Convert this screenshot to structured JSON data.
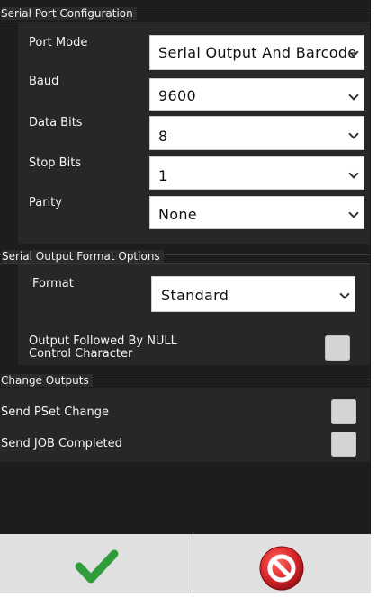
{
  "serial_port": {
    "title": "Serial Port Configuration",
    "port_mode": {
      "label": "Port Mode",
      "value": "Serial Output And Barcode"
    },
    "baud": {
      "label": "Baud",
      "value": "9600"
    },
    "data_bits": {
      "label": "Data Bits",
      "value": "8"
    },
    "stop_bits": {
      "label": "Stop Bits",
      "value": "1"
    },
    "parity": {
      "label": "Parity",
      "value": "None"
    }
  },
  "format_options": {
    "title": "Serial Output Format Options",
    "format": {
      "label": "Format",
      "value": "Standard"
    },
    "null_char": {
      "label_line1": "Output Followed By NULL",
      "label_line2": "Control Character",
      "checked": false
    }
  },
  "change_outputs": {
    "title": "Change Outputs",
    "pset": {
      "label": "Send PSet Change",
      "checked": false
    },
    "job": {
      "label": "Send JOB Completed",
      "checked": false
    }
  },
  "footer": {
    "confirm_icon": "checkmark-icon",
    "cancel_icon": "cancel-icon",
    "accent_green": "#2e9d3a",
    "accent_red": "#d9262b"
  }
}
